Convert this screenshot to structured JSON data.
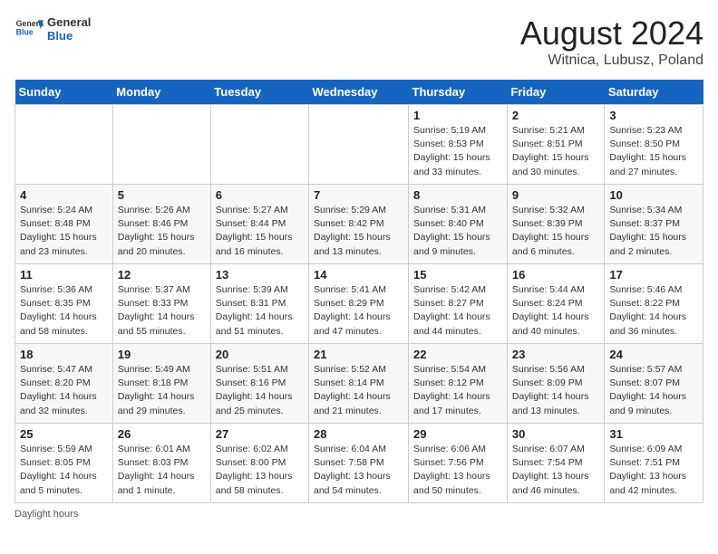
{
  "header": {
    "logo_general": "General",
    "logo_blue": "Blue",
    "month_year": "August 2024",
    "location": "Witnica, Lubusz, Poland"
  },
  "days_of_week": [
    "Sunday",
    "Monday",
    "Tuesday",
    "Wednesday",
    "Thursday",
    "Friday",
    "Saturday"
  ],
  "weeks": [
    [
      {
        "day": "",
        "info": ""
      },
      {
        "day": "",
        "info": ""
      },
      {
        "day": "",
        "info": ""
      },
      {
        "day": "",
        "info": ""
      },
      {
        "day": "1",
        "info": "Sunrise: 5:19 AM\nSunset: 8:53 PM\nDaylight: 15 hours\nand 33 minutes."
      },
      {
        "day": "2",
        "info": "Sunrise: 5:21 AM\nSunset: 8:51 PM\nDaylight: 15 hours\nand 30 minutes."
      },
      {
        "day": "3",
        "info": "Sunrise: 5:23 AM\nSunset: 8:50 PM\nDaylight: 15 hours\nand 27 minutes."
      }
    ],
    [
      {
        "day": "4",
        "info": "Sunrise: 5:24 AM\nSunset: 8:48 PM\nDaylight: 15 hours\nand 23 minutes."
      },
      {
        "day": "5",
        "info": "Sunrise: 5:26 AM\nSunset: 8:46 PM\nDaylight: 15 hours\nand 20 minutes."
      },
      {
        "day": "6",
        "info": "Sunrise: 5:27 AM\nSunset: 8:44 PM\nDaylight: 15 hours\nand 16 minutes."
      },
      {
        "day": "7",
        "info": "Sunrise: 5:29 AM\nSunset: 8:42 PM\nDaylight: 15 hours\nand 13 minutes."
      },
      {
        "day": "8",
        "info": "Sunrise: 5:31 AM\nSunset: 8:40 PM\nDaylight: 15 hours\nand 9 minutes."
      },
      {
        "day": "9",
        "info": "Sunrise: 5:32 AM\nSunset: 8:39 PM\nDaylight: 15 hours\nand 6 minutes."
      },
      {
        "day": "10",
        "info": "Sunrise: 5:34 AM\nSunset: 8:37 PM\nDaylight: 15 hours\nand 2 minutes."
      }
    ],
    [
      {
        "day": "11",
        "info": "Sunrise: 5:36 AM\nSunset: 8:35 PM\nDaylight: 14 hours\nand 58 minutes."
      },
      {
        "day": "12",
        "info": "Sunrise: 5:37 AM\nSunset: 8:33 PM\nDaylight: 14 hours\nand 55 minutes."
      },
      {
        "day": "13",
        "info": "Sunrise: 5:39 AM\nSunset: 8:31 PM\nDaylight: 14 hours\nand 51 minutes."
      },
      {
        "day": "14",
        "info": "Sunrise: 5:41 AM\nSunset: 8:29 PM\nDaylight: 14 hours\nand 47 minutes."
      },
      {
        "day": "15",
        "info": "Sunrise: 5:42 AM\nSunset: 8:27 PM\nDaylight: 14 hours\nand 44 minutes."
      },
      {
        "day": "16",
        "info": "Sunrise: 5:44 AM\nSunset: 8:24 PM\nDaylight: 14 hours\nand 40 minutes."
      },
      {
        "day": "17",
        "info": "Sunrise: 5:46 AM\nSunset: 8:22 PM\nDaylight: 14 hours\nand 36 minutes."
      }
    ],
    [
      {
        "day": "18",
        "info": "Sunrise: 5:47 AM\nSunset: 8:20 PM\nDaylight: 14 hours\nand 32 minutes."
      },
      {
        "day": "19",
        "info": "Sunrise: 5:49 AM\nSunset: 8:18 PM\nDaylight: 14 hours\nand 29 minutes."
      },
      {
        "day": "20",
        "info": "Sunrise: 5:51 AM\nSunset: 8:16 PM\nDaylight: 14 hours\nand 25 minutes."
      },
      {
        "day": "21",
        "info": "Sunrise: 5:52 AM\nSunset: 8:14 PM\nDaylight: 14 hours\nand 21 minutes."
      },
      {
        "day": "22",
        "info": "Sunrise: 5:54 AM\nSunset: 8:12 PM\nDaylight: 14 hours\nand 17 minutes."
      },
      {
        "day": "23",
        "info": "Sunrise: 5:56 AM\nSunset: 8:09 PM\nDaylight: 14 hours\nand 13 minutes."
      },
      {
        "day": "24",
        "info": "Sunrise: 5:57 AM\nSunset: 8:07 PM\nDaylight: 14 hours\nand 9 minutes."
      }
    ],
    [
      {
        "day": "25",
        "info": "Sunrise: 5:59 AM\nSunset: 8:05 PM\nDaylight: 14 hours\nand 5 minutes."
      },
      {
        "day": "26",
        "info": "Sunrise: 6:01 AM\nSunset: 8:03 PM\nDaylight: 14 hours\nand 1 minute."
      },
      {
        "day": "27",
        "info": "Sunrise: 6:02 AM\nSunset: 8:00 PM\nDaylight: 13 hours\nand 58 minutes."
      },
      {
        "day": "28",
        "info": "Sunrise: 6:04 AM\nSunset: 7:58 PM\nDaylight: 13 hours\nand 54 minutes."
      },
      {
        "day": "29",
        "info": "Sunrise: 6:06 AM\nSunset: 7:56 PM\nDaylight: 13 hours\nand 50 minutes."
      },
      {
        "day": "30",
        "info": "Sunrise: 6:07 AM\nSunset: 7:54 PM\nDaylight: 13 hours\nand 46 minutes."
      },
      {
        "day": "31",
        "info": "Sunrise: 6:09 AM\nSunset: 7:51 PM\nDaylight: 13 hours\nand 42 minutes."
      }
    ]
  ],
  "footer": "Daylight hours"
}
